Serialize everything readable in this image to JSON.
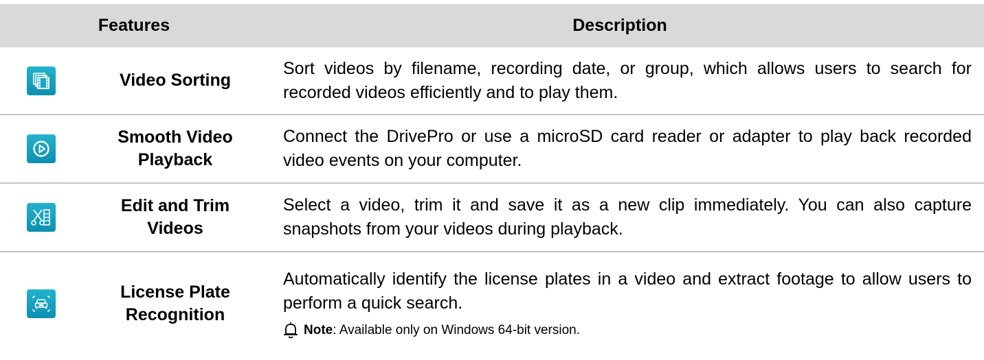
{
  "header": {
    "features": "Features",
    "description": "Description"
  },
  "rows": [
    {
      "icon": "video-sorting-icon",
      "feature_lines": [
        "Video Sorting"
      ],
      "description": "Sort videos by filename, recording date, or group, which allows users to search for recorded videos efficiently and to play them."
    },
    {
      "icon": "play-circle-icon",
      "feature_lines": [
        "Smooth Video",
        "Playback"
      ],
      "description": "Connect the DrivePro or use a microSD card reader or adapter to play back recorded video events on your computer."
    },
    {
      "icon": "scissors-film-icon",
      "feature_lines": [
        "Edit and Trim",
        "Videos"
      ],
      "description": "Select a video, trim it and save it as a new clip immediately. You can also capture snapshots from your videos during playback."
    },
    {
      "icon": "car-plate-icon",
      "feature_lines": [
        "License Plate",
        "Recognition"
      ],
      "description": "Automatically identify the license plates in a video and extract footage to allow users to perform a quick search.",
      "note_label": "Note",
      "note_text": ": Available only on Windows 64-bit version."
    }
  ],
  "colors": {
    "header_bg": "#d9d9d9",
    "icon_accent": "#1aa6c4",
    "divider": "#c4c4c4"
  }
}
